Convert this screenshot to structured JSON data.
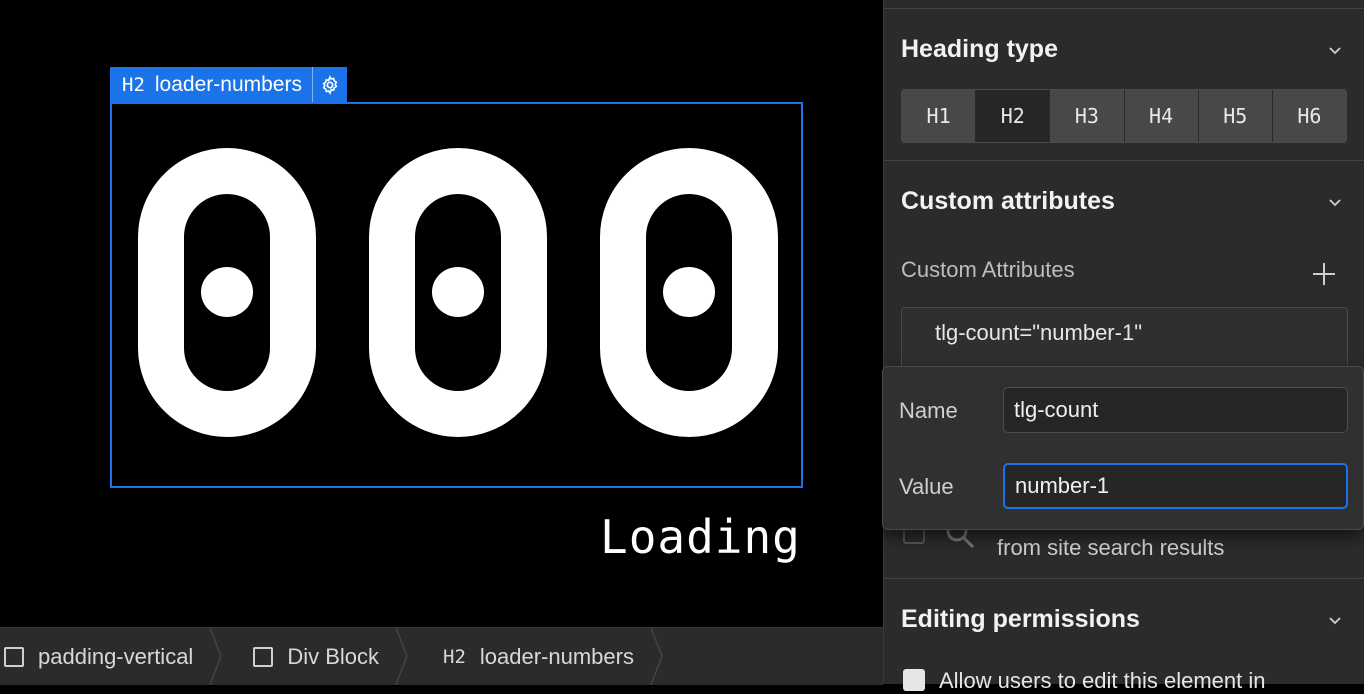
{
  "canvas": {
    "selected_tag": "H2",
    "selected_class": "loader-numbers",
    "digits": "000",
    "loading_text": "Loading"
  },
  "breadcrumb": {
    "items": [
      {
        "label": "padding-vertical",
        "icon": "box-icon"
      },
      {
        "label": "Div Block",
        "icon": "box-icon"
      },
      {
        "tag": "H2",
        "label": "loader-numbers"
      }
    ]
  },
  "panel": {
    "heading_type": {
      "title": "Heading type",
      "options": [
        "H1",
        "H2",
        "H3",
        "H4",
        "H5",
        "H6"
      ],
      "selected": "H2"
    },
    "custom_attributes": {
      "title": "Custom attributes",
      "label": "Custom Attributes",
      "entry": "tlg-count=\"number-1\""
    },
    "seo": {
      "text": "from site search results"
    },
    "editing_permissions": {
      "title": "Editing permissions",
      "allow_text": "Allow users to edit this element in"
    }
  },
  "popup": {
    "name_label": "Name",
    "name_value": "tlg-count",
    "value_label": "Value",
    "value_value": "number-1"
  },
  "colors": {
    "accent": "#1a73e8",
    "panel_bg": "#2b2b2b",
    "canvas_bg": "#000000"
  }
}
